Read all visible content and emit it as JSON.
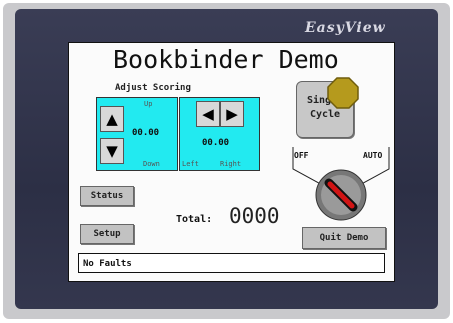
{
  "device": {
    "brand": "EasyView"
  },
  "screen": {
    "title": "Bookbinder Demo",
    "scoring": {
      "label": "Adjust Scoring",
      "vertical": {
        "top_label": "Up",
        "bottom_label": "Down",
        "value": "00.00"
      },
      "horizontal": {
        "value": "00.00",
        "left_label": "Left",
        "right_label": "Right"
      }
    },
    "single_cycle": {
      "line1": "Single",
      "line2": "Cycle"
    },
    "selector": {
      "off_label": "OFF",
      "auto_label": "AUTO",
      "position": "OFF"
    },
    "buttons": {
      "status": "Status",
      "setup": "Setup",
      "quit": "Quit Demo"
    },
    "total": {
      "label": "Total:",
      "value": "0000"
    },
    "status_message": "No Faults",
    "colors": {
      "panel": "#22eaf0",
      "indicator": "#b59a1d",
      "selector_handle": "#d11414"
    }
  }
}
